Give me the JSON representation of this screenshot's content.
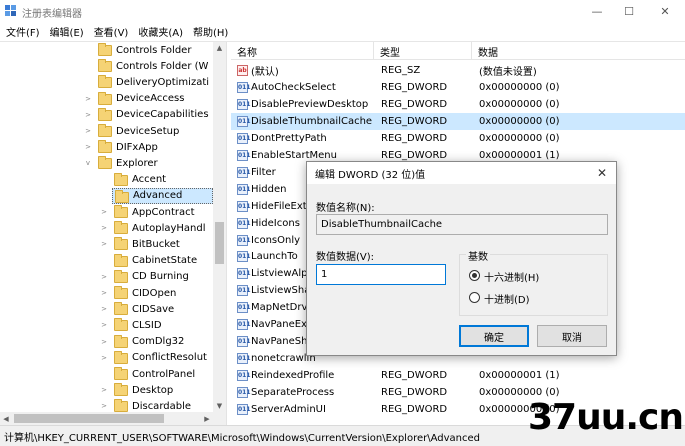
{
  "window": {
    "title": "注册表编辑器",
    "minimize_glyph": "—",
    "maximize_glyph": "☐",
    "close_glyph": "✕"
  },
  "menu": [
    "文件(F)",
    "编辑(E)",
    "查看(V)",
    "收藏夹(A)",
    "帮助(H)"
  ],
  "tree": {
    "items": [
      {
        "label": "Controls Folder",
        "expander": ""
      },
      {
        "label": "Controls Folder (W",
        "expander": ""
      },
      {
        "label": "DeliveryOptimizati",
        "expander": ""
      },
      {
        "label": "DeviceAccess",
        "expander": ">"
      },
      {
        "label": "DeviceCapabilities",
        "expander": ">"
      },
      {
        "label": "DeviceSetup",
        "expander": ">"
      },
      {
        "label": "DIFxApp",
        "expander": ">"
      },
      {
        "label": "Explorer",
        "expander": "v"
      },
      {
        "label": "Accent",
        "expander": ""
      },
      {
        "label": "Advanced",
        "expander": ""
      },
      {
        "label": "AppContract",
        "expander": ">"
      },
      {
        "label": "AutoplayHandl",
        "expander": ">"
      },
      {
        "label": "BitBucket",
        "expander": ">"
      },
      {
        "label": "CabinetState",
        "expander": ""
      },
      {
        "label": "CD Burning",
        "expander": ">"
      },
      {
        "label": "CIDOpen",
        "expander": ">"
      },
      {
        "label": "CIDSave",
        "expander": ">"
      },
      {
        "label": "CLSID",
        "expander": ">"
      },
      {
        "label": "ComDlg32",
        "expander": ">"
      },
      {
        "label": "ConflictResolut",
        "expander": ">"
      },
      {
        "label": "ControlPanel",
        "expander": ""
      },
      {
        "label": "Desktop",
        "expander": ">"
      },
      {
        "label": "Discardable",
        "expander": ">"
      }
    ]
  },
  "list": {
    "columns": [
      "名称",
      "类型",
      "数据"
    ],
    "rows": [
      {
        "name": "(默认)",
        "type": "REG_SZ",
        "data": "(数值未设置)",
        "icon": "ab"
      },
      {
        "name": "AutoCheckSelect",
        "type": "REG_DWORD",
        "data": "0x00000000 (0)",
        "icon": "011"
      },
      {
        "name": "DisablePreviewDesktop",
        "type": "REG_DWORD",
        "data": "0x00000000 (0)",
        "icon": "011"
      },
      {
        "name": "DisableThumbnailCache",
        "type": "REG_DWORD",
        "data": "0x00000000 (0)",
        "icon": "011"
      },
      {
        "name": "DontPrettyPath",
        "type": "REG_DWORD",
        "data": "0x00000000 (0)",
        "icon": "011"
      },
      {
        "name": "EnableStartMenu",
        "type": "REG_DWORD",
        "data": "0x00000001 (1)",
        "icon": "011"
      },
      {
        "name": "Filter",
        "type": "",
        "data": "",
        "icon": "011"
      },
      {
        "name": "Hidden",
        "type": "",
        "data": "",
        "icon": "011"
      },
      {
        "name": "HideFileExt",
        "type": "",
        "data": "",
        "icon": "011"
      },
      {
        "name": "HideIcons",
        "type": "",
        "data": "",
        "icon": "011"
      },
      {
        "name": "IconsOnly",
        "type": "",
        "data": "",
        "icon": "011"
      },
      {
        "name": "LaunchTo",
        "type": "",
        "data": "",
        "icon": "011"
      },
      {
        "name": "ListviewAlph",
        "type": "",
        "data": "",
        "icon": "011"
      },
      {
        "name": "ListviewShad",
        "type": "",
        "data": "",
        "icon": "011"
      },
      {
        "name": "MapNetDrv",
        "type": "",
        "data": "",
        "icon": "011"
      },
      {
        "name": "NavPaneExp",
        "type": "",
        "data": "",
        "icon": "011"
      },
      {
        "name": "NavPaneSho",
        "type": "",
        "data": "",
        "icon": "011"
      },
      {
        "name": "nonetcrawlin",
        "type": "",
        "data": "",
        "icon": "011"
      },
      {
        "name": "ReindexedProfile",
        "type": "REG_DWORD",
        "data": "0x00000001 (1)",
        "icon": "011"
      },
      {
        "name": "SeparateProcess",
        "type": "REG_DWORD",
        "data": "0x00000000 (0)",
        "icon": "011"
      },
      {
        "name": "ServerAdminUI",
        "type": "REG_DWORD",
        "data": "0x00000000 (0)",
        "icon": "011"
      }
    ]
  },
  "status": {
    "path": "计算机\\HKEY_CURRENT_USER\\SOFTWARE\\Microsoft\\Windows\\CurrentVersion\\Explorer\\Advanced"
  },
  "watermark": "37uu.cn",
  "dialog": {
    "title": "编辑 DWORD (32 位)值",
    "name_label": "数值名称(N):",
    "name_value": "DisableThumbnailCache",
    "data_label": "数值数据(V):",
    "data_value": "1",
    "base_label": "基数",
    "hex_label": "十六进制(H)",
    "dec_label": "十进制(D)",
    "ok_label": "确定",
    "cancel_label": "取消",
    "close_glyph": "✕"
  }
}
